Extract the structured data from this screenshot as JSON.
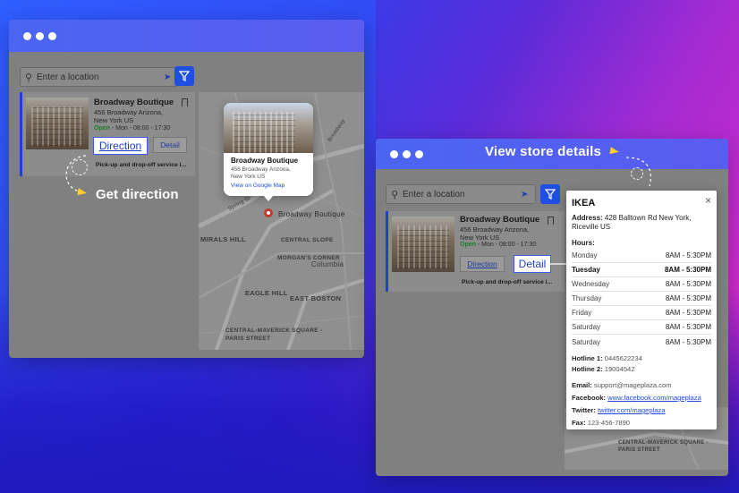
{
  "left_window": {
    "search": {
      "placeholder": "Enter a location"
    },
    "store": {
      "name": "Broadway Boutique",
      "address_line1": "456 Broadway Arizona,",
      "address_line2": "New York US",
      "status": "Open",
      "hours": " - Mon - 08:00 - 17:30",
      "direction_label": "Direction",
      "detail_label": "Detail",
      "pickup": "Pick-up and drop-off service i..."
    },
    "popup": {
      "name": "Broadway Boutique",
      "address_line1": "456 Broadway Arizona,",
      "address_line2": "New York US",
      "link": "View on Google Map"
    },
    "map": {
      "pin_label": "Broadway Boutique",
      "labels": [
        "MIRALS HILL",
        "CENTRAL SLOPE",
        "MORGAN'S CORNER",
        "Columbia",
        "EAGLE HILL",
        "EAST BOSTON",
        "CENTRAL-MAVERICK SQUARE - PARIS STREET",
        "Spring St",
        "Broadway"
      ]
    }
  },
  "callouts": {
    "get_direction": "Get direction",
    "view_store_details": "View store details"
  },
  "right_window": {
    "search": {
      "placeholder": "Enter a location"
    },
    "store": {
      "name": "Broadway Boutique",
      "address_line1": "456 Broadway Arizona,",
      "address_line2": "New York US",
      "status": "Open",
      "hours": " - Mon - 08:00 - 17:30",
      "direction_label": "Direction",
      "detail_label": "Detail",
      "pickup": "Pick-up and drop-off service i..."
    },
    "details": {
      "title": "IKEA",
      "address_label": "Address:",
      "address_value": " 428 Balltown Rd New York, Riceville US",
      "hours_label": "Hours:",
      "hours": [
        {
          "day": "Monday",
          "time": "8AM - 5:30PM"
        },
        {
          "day": "Tuesday",
          "time": "8AM - 5:30PM"
        },
        {
          "day": "Wednesday",
          "time": "8AM - 5:30PM"
        },
        {
          "day": "Thursday",
          "time": "8AM - 5:30PM"
        },
        {
          "day": "Friday",
          "time": "8AM - 5:30PM"
        },
        {
          "day": "Saturday",
          "time": "8AM - 5:30PM"
        },
        {
          "day": "Saturday",
          "time": "8AM - 5:30PM"
        }
      ],
      "hotline1_label": "Hotline 1:",
      "hotline1": " 0445622234",
      "hotline2_label": "Hotline 2:",
      "hotline2": " 19004542",
      "email_label": "Email:",
      "email": " support@mageplaza.com",
      "facebook_label": "Facebook:",
      "facebook": "www.facebook.com/mageplaza",
      "twitter_label": "Twitter:",
      "twitter": "twitter.com/mageplaza",
      "fax_label": "Fax:",
      "fax": " 123-456-7890",
      "close_icon": "×"
    },
    "map_label": "CENTRAL-MAVERICK SQUARE - PARIS STREET"
  },
  "colors": {
    "accent": "#1e4fe0",
    "title_bar": "#4b65f2",
    "open": "#1b7d2a"
  }
}
